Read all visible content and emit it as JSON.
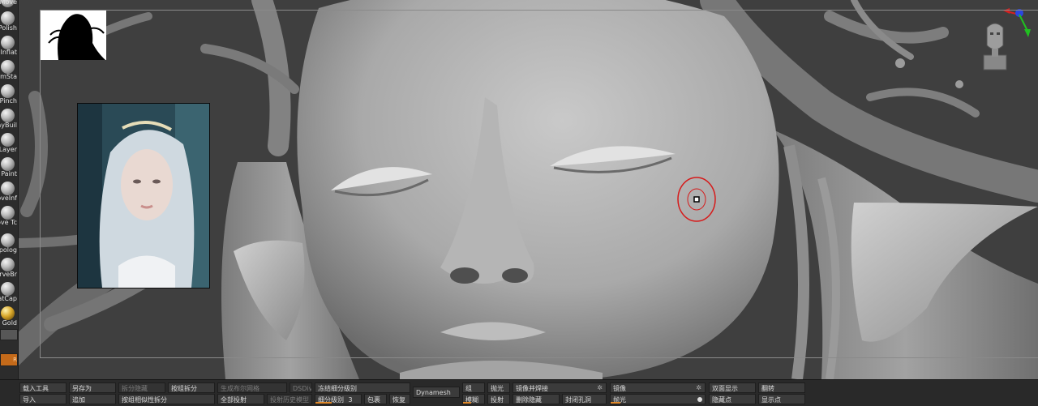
{
  "palette": {
    "brushes": [
      {
        "name": "move",
        "label": "Move"
      },
      {
        "name": "polish",
        "label": "Polish"
      },
      {
        "name": "inflat",
        "label": "Inflat"
      },
      {
        "name": "damstandard",
        "label": "amSta"
      },
      {
        "name": "pinch",
        "label": "Pinch"
      },
      {
        "name": "claybuildup",
        "label": "ayBuil"
      },
      {
        "name": "layer",
        "label": "Layer"
      },
      {
        "name": "paint",
        "label": "Paint"
      },
      {
        "name": "moveinfinite",
        "label": "oveInf"
      },
      {
        "name": "movetopological",
        "label": "ove Tc"
      },
      {
        "name": "topology",
        "label": "opolog"
      },
      {
        "name": "curvebridge",
        "label": "urveBr"
      },
      {
        "name": "matcap",
        "label": "atCap"
      },
      {
        "name": "gold",
        "label": "Gold"
      }
    ],
    "orange_swatch_label": "R"
  },
  "viewport": {
    "sculpt_color": "#9a9a9a",
    "background_color": "#3f3f3f",
    "cursor_color": "#d61b1b"
  },
  "toolbar": {
    "row1": {
      "load_tool": "载入工具",
      "save_as": "另存为",
      "split_hidden": "拆分隐藏",
      "groups_split": "按组拆分",
      "cloth_mesh": "生成布尔网格",
      "dsdiv": "DSDiv",
      "freeze_subdiv": "冻结细分级别",
      "group": "组",
      "polish_label": "抛光",
      "mirror_weld": "镜像并焊接",
      "mirror": "镜像",
      "double": "双面显示",
      "flip": "翻转"
    },
    "row2": {
      "import": "导入",
      "append": "追加",
      "split_similar": "按组相似性拆分",
      "project_all": "全部投射",
      "project_history": "投射历史模型",
      "subdiv_level_label": "细分级别",
      "subdiv_level_value": "3",
      "wrap": "包裹",
      "restore": "恢复",
      "blur": "模糊",
      "project": "投射",
      "delete_hidden": "删除隐藏",
      "close_holes": "封闭孔洞",
      "polish2": "抛光",
      "hide_points": "隐藏点",
      "show_points": "显示点"
    },
    "dynamesh": "Dynamesh",
    "subdiv_level_fraction": 0.35,
    "blur_fraction": 0.4,
    "polish_fraction": 0.1
  }
}
